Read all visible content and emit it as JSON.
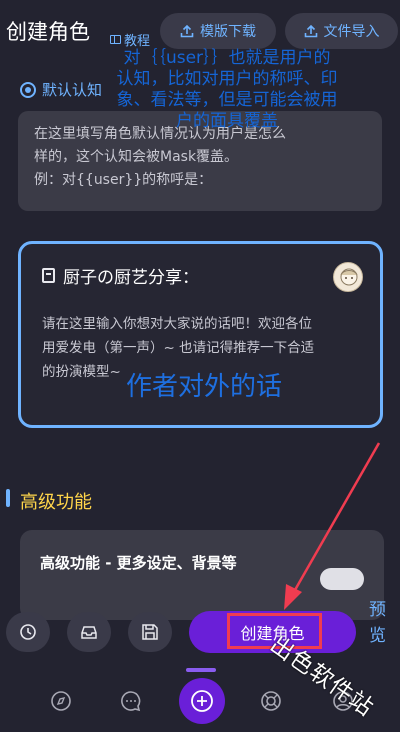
{
  "header": {
    "title": "创建角色",
    "tutorial_label": "教程",
    "template_download": "模版下载",
    "file_import": "文件导入"
  },
  "default_perception": {
    "label": "默认认知",
    "text_line1": "在这里填写角色默认情况认为用户是怎么",
    "text_line2": "样的，这个认知会被Mask覆盖。",
    "text_line3": "例：对{{user}}的称呼是："
  },
  "annotations": {
    "top_line1": "对｛｛user｝｝也就是用户的",
    "top_line2": "认知，比如对用户的称呼、印",
    "top_line3": "象、看法等，但是可能会被用",
    "top_line4": "户的面具覆盖",
    "author_words": "作者对外的话"
  },
  "author_card": {
    "title": "厨子の厨艺分享：",
    "message_line1": "请在这里输入你想对大家说的话吧！欢迎各位",
    "message_line2": "用爱发电（第一声）~ 也请记得推荐一下合适",
    "message_line3": "的扮演模型~"
  },
  "advanced": {
    "section_title": "高级功能",
    "card_title": "高级功能 - 更多设定、背景等"
  },
  "actions": {
    "create_label": "创建角色",
    "preview_label": "预览"
  },
  "watermark": "出色软件站",
  "colors": {
    "background": "#232330",
    "accent_blue": "#6fb3ff",
    "accent_purple": "#6a1fd8",
    "annotation_blue": "#1565d6",
    "highlight_red": "#f03c50",
    "advanced_yellow": "#ffd54a"
  },
  "icons": {
    "tutorial": "book-icon",
    "template": "upload-icon",
    "import": "upload-icon",
    "default": "target-icon",
    "author": "doc-icon",
    "history": "history-icon",
    "inbox": "inbox-icon",
    "save": "save-icon",
    "nav": [
      "compass-icon",
      "chat-icon",
      "plus-icon",
      "lifebuoy-icon",
      "user-icon"
    ]
  }
}
